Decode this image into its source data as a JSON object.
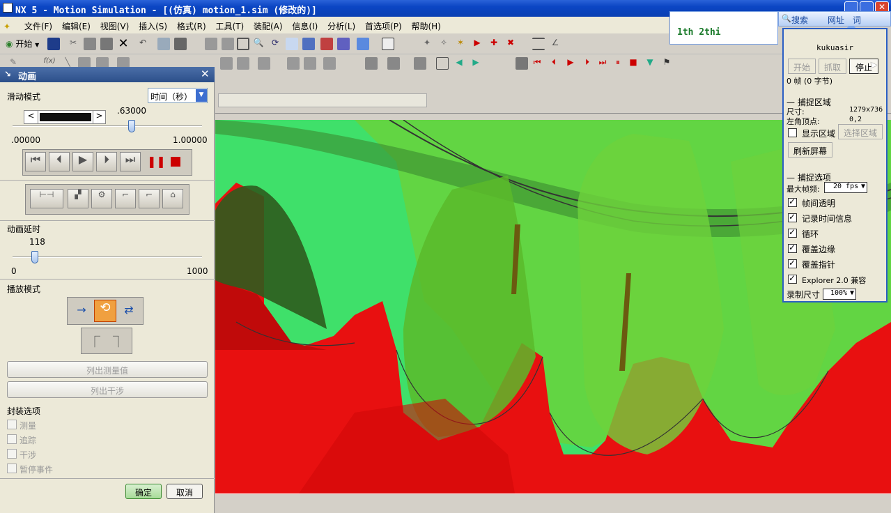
{
  "window": {
    "title": "NX 5 - Motion Simulation - [(仿真) motion_1.sim (修改的)]"
  },
  "menubar": {
    "items": [
      "文件(F)",
      "编辑(E)",
      "视图(V)",
      "插入(S)",
      "格式(R)",
      "工具(T)",
      "装配(A)",
      "信息(I)",
      "分析(L)",
      "首选项(P)",
      "帮助(H)"
    ]
  },
  "toolbar": {
    "start_label": "开始"
  },
  "panel": {
    "title": "动画",
    "slide_mode_label": "滑动模式",
    "slide_mode_value": "时间（秒）",
    "time_value": ".63000",
    "time_min": ".00000",
    "time_max": "1.00000",
    "time_position": 0.63,
    "delay_label": "动画延时",
    "delay_value": "118",
    "delay_min": "0",
    "delay_max": "1000",
    "delay_position": 0.118,
    "play_mode_label": "播放模式",
    "list_measure_label": "列出测量值",
    "list_interference_label": "列出干涉",
    "wrap_options_label": "封装选项",
    "wrap_options": [
      "测量",
      "追踪",
      "干涉",
      "暂停事件"
    ],
    "ok_label": "确定",
    "cancel_label": "取消"
  },
  "notif": {
    "text": "1th 2thi",
    "search_label": "搜索",
    "url_label": "网址",
    "word_label": "词"
  },
  "recorder": {
    "user": "kukuasir",
    "start_label": "开始",
    "capture_label": "抓取",
    "stop_label": "停止",
    "frames_text": "0 帧 (0 字节)",
    "capture_area_label": "捕捉区域",
    "size_label": "尺寸:",
    "size_value": "1279x736",
    "topleft_label": "左角顶点:",
    "topleft_value": "0,2",
    "show_area_label": "显示区域",
    "select_area_label": "选择区域",
    "refresh_label": "刷新屏幕",
    "capture_options_label": "捕捉选项",
    "max_fps_label": "最大帧频:",
    "max_fps_value": "20 fps",
    "options": [
      {
        "label": "帧间透明",
        "checked": true
      },
      {
        "label": "记录时间信息",
        "checked": true
      },
      {
        "label": "循环",
        "checked": true
      },
      {
        "label": "覆盖边缘",
        "checked": true
      },
      {
        "label": "覆盖指针",
        "checked": true
      },
      {
        "label": "Explorer 2.0 兼容",
        "checked": true
      }
    ],
    "rec_size_label": "录制尺寸",
    "rec_size_value": "100%"
  },
  "colors": {
    "gear": "#3fe06a",
    "rack": "#e81010",
    "titlebar": "#0b46c4"
  }
}
